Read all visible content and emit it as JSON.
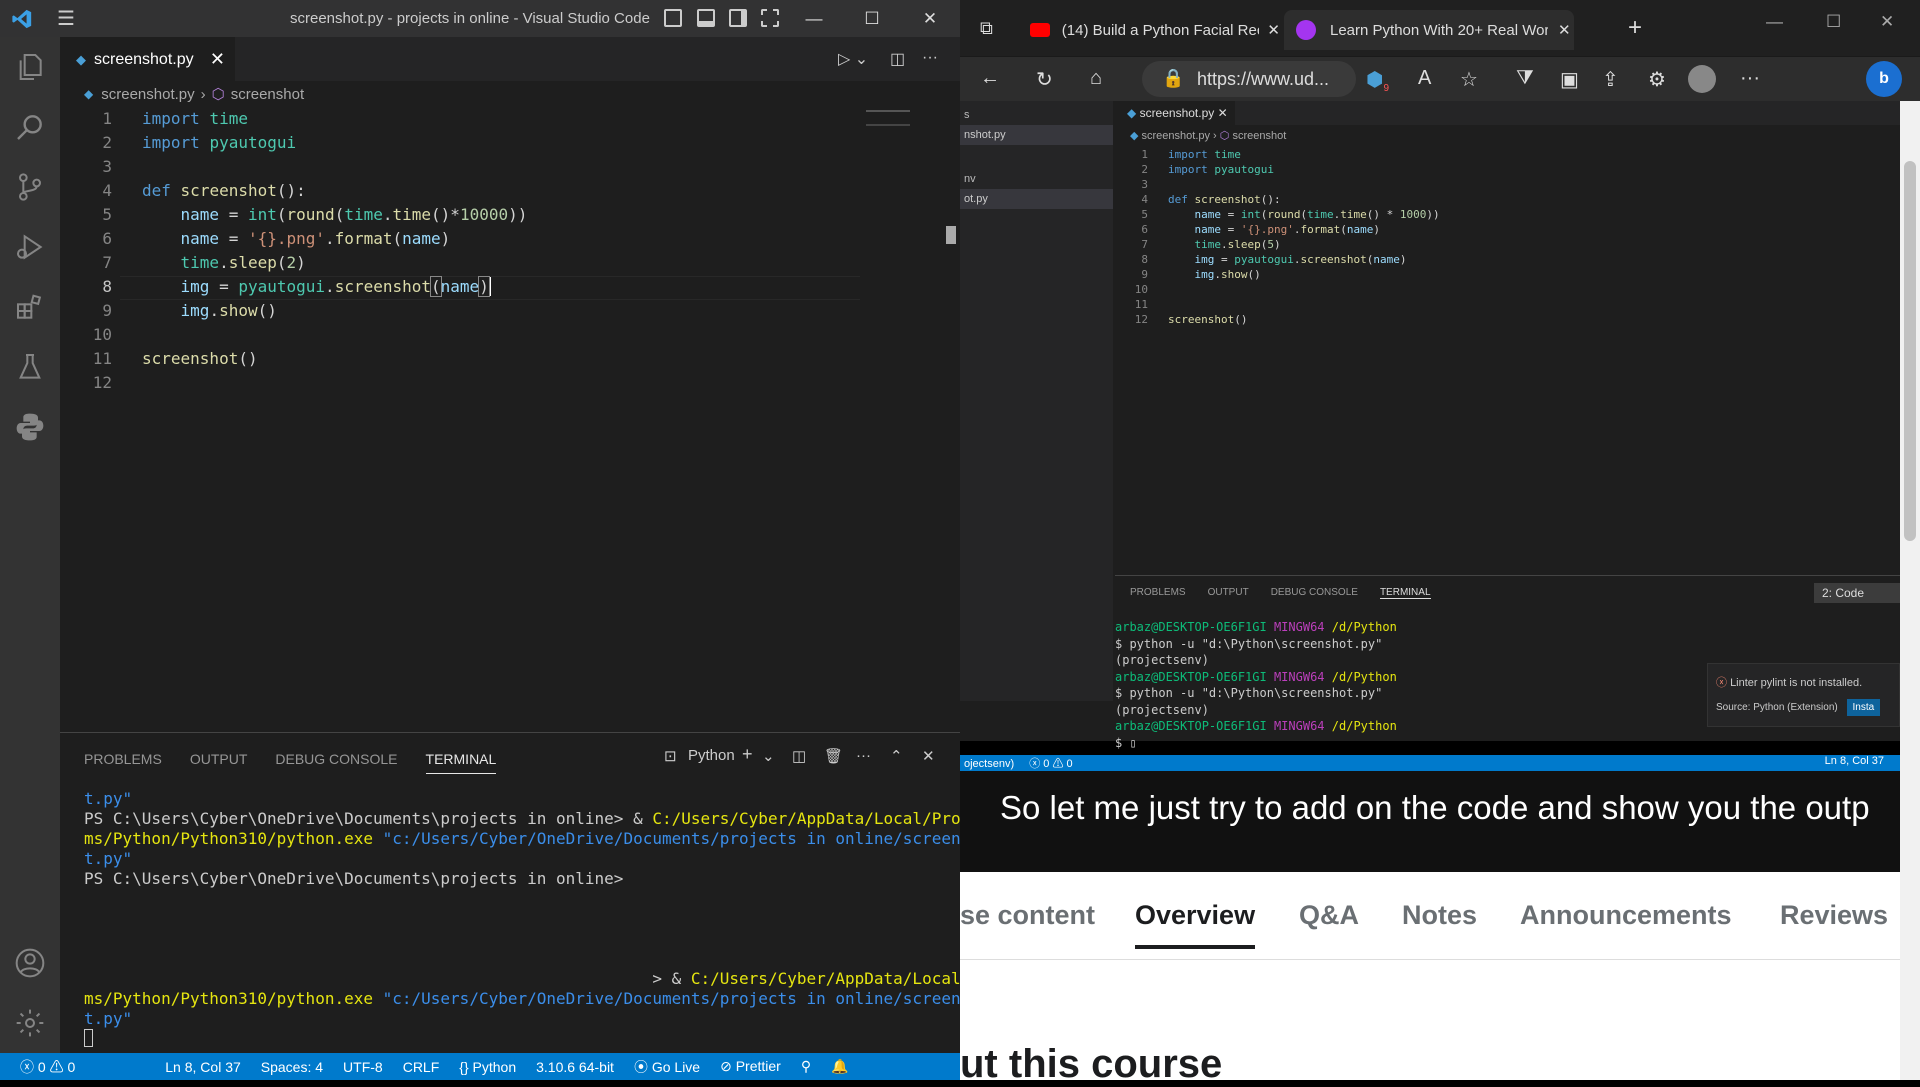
{
  "vscode": {
    "title": "screenshot.py - projects in online - Visual Studio Code",
    "tab_label": "screenshot.py",
    "breadcrumb": {
      "file": "screenshot.py",
      "symbol": "screenshot"
    },
    "line_numbers": [
      "1",
      "2",
      "3",
      "4",
      "5",
      "6",
      "7",
      "8",
      "9",
      "10",
      "11",
      "12"
    ],
    "panel_tabs": [
      "PROBLEMS",
      "OUTPUT",
      "DEBUG CONSOLE",
      "TERMINAL"
    ],
    "active_panel_tab": "TERMINAL",
    "terminal_profile": "Python",
    "terminal": {
      "l1": "t.py\"",
      "l2_prompt": "PS C:\\Users\\Cyber\\OneDrive\\Documents\\projects in online> & ",
      "l2_path": "C:/Users/Cyber/AppData/Local/Progra",
      "l3_path": "ms/Python/Python310/python.exe",
      "l3_str": " \"c:/Users/Cyber/OneDrive/Documents/projects in online/screensho",
      "l4": "t.py\"",
      "l5": "PS C:\\Users\\Cyber\\OneDrive\\Documents\\projects in online>",
      "l6_prompt": "                                                           > & ",
      "l6_path": "C:/Users/Cyber/AppData/Local/Progra",
      "l7_path": "ms/Python/Python310/python.exe",
      "l7_str": " \"c:/Users/Cyber/OneDrive/Documents/projects in online/screensho",
      "l8": "t.py\""
    },
    "status": {
      "problems": "0",
      "warnings": "0",
      "position": "Ln 8, Col 37",
      "spaces": "Spaces: 4",
      "encoding": "UTF-8",
      "eol": "CRLF",
      "language": "Python",
      "interpreter": "3.10.6 64-bit",
      "golive": "Go Live",
      "prettier": "Prettier"
    }
  },
  "edge": {
    "tab1": "(14) Build a Python Facial Recogn",
    "tab2": "Learn Python With 20+ Real Wor",
    "address": "https://www.ud...",
    "shield_count": "9",
    "video": {
      "tab": "screenshot.py",
      "breadcrumb_file": "screenshot.py",
      "breadcrumb_symbol": "screenshot",
      "side_items": [
        "s",
        "nshot.py",
        "nv",
        "ot.py"
      ],
      "line_numbers": [
        "1",
        "2",
        "3",
        "4",
        "5",
        "6",
        "7",
        "8",
        "9",
        "10",
        "11",
        "12"
      ],
      "panel_tabs": [
        "PROBLEMS",
        "OUTPUT",
        "DEBUG CONSOLE",
        "TERMINAL"
      ],
      "panel_select": "2: Code",
      "term": {
        "a1": "arbaz@DESKTOP-OE6F1GI",
        "b1": "MINGW64",
        "c1": "/d/Python",
        "cmd1": "$ python -u \"d:\\Python\\screenshot.py\"",
        "env1": "(projectsenv)",
        "a2": "arbaz@DESKTOP-OE6F1GI",
        "b2": "MINGW64",
        "c2": "/d/Python",
        "cmd2": "$ python -u \"d:\\Python\\screenshot.py\"",
        "env2": "(projectsenv)",
        "a3": "arbaz@DESKTOP-OE6F1GI",
        "b3": "MINGW64",
        "c3": "/d/Python",
        "cmd3": "$"
      },
      "notif": "Linter pylint is not installed.",
      "notif_source": "Source: Python (Extension)",
      "notif_button": "Insta",
      "status_left": "ojectsenv)",
      "status_errors": "0",
      "status_warnings": "0",
      "status_right": "Ln 8, Col 37",
      "caption": "So let me just try to add on the code and show you the outp"
    },
    "course_tabs": [
      "se content",
      "Overview",
      "Q&A",
      "Notes",
      "Announcements",
      "Reviews"
    ],
    "active_course_tab": "Overview",
    "heading": "ut this course"
  }
}
